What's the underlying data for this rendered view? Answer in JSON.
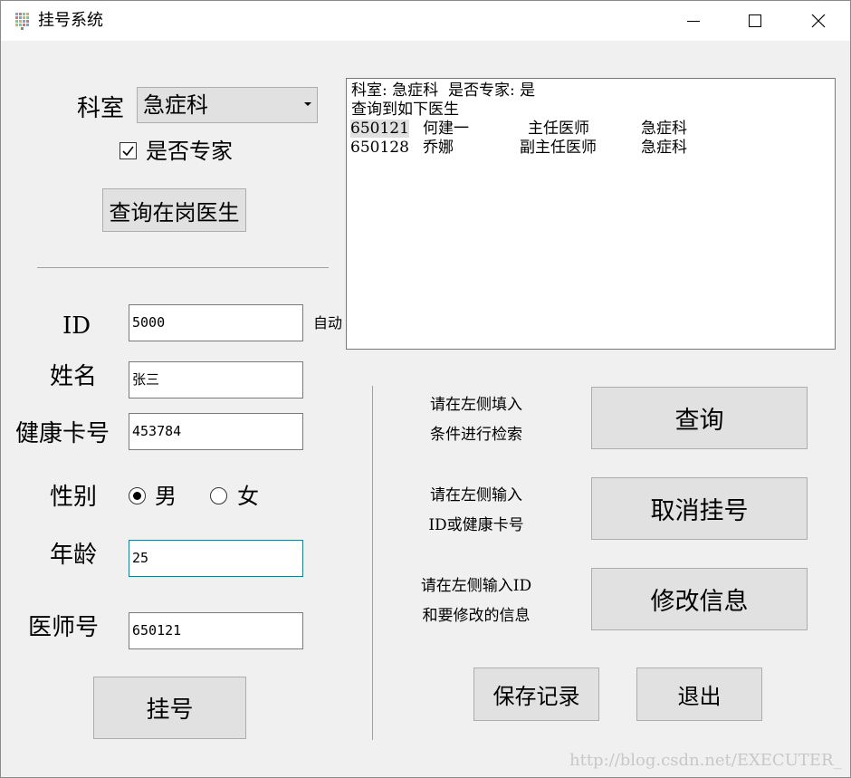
{
  "window": {
    "title": "挂号系统"
  },
  "query_panel": {
    "department_label": "科室",
    "department_value": "急症科",
    "expert_label": "是否专家",
    "expert_checked": true,
    "query_doctors_button": "查询在岗医生"
  },
  "result": {
    "summary_line": "科室: 急症科  是否专家: 是",
    "found_line": "查询到如下医生",
    "rows": [
      {
        "id": "650121",
        "name": "何建一",
        "title": "主任医师",
        "dept": "急症科"
      },
      {
        "id": "650128",
        "name": "乔娜",
        "title": "副主任医师",
        "dept": "急症科"
      }
    ]
  },
  "form": {
    "id_label": "ID",
    "id_value": "5000",
    "id_auto_label": "自动",
    "name_label": "姓名",
    "name_value": "张三",
    "card_label": "健康卡号",
    "card_value": "453784",
    "gender_label": "性别",
    "gender_male": "男",
    "gender_female": "女",
    "gender_selected": "男",
    "age_label": "年龄",
    "age_value": "25",
    "doctor_no_label": "医师号",
    "doctor_no_value": "650121",
    "register_button": "挂号"
  },
  "actions": {
    "search_hint_1": "请在左侧填入",
    "search_hint_2": "条件进行检索",
    "search_button": "查询",
    "cancel_hint_1": "请在左侧输入",
    "cancel_hint_2": "ID或健康卡号",
    "cancel_button": "取消挂号",
    "modify_hint_1": "请在左侧输入ID",
    "modify_hint_2": "和要修改的信息",
    "modify_button": "修改信息",
    "save_button": "保存记录",
    "exit_button": "退出"
  },
  "watermark": "http://blog.csdn.net/EXECUTER_",
  "icons": {
    "app": "app-grid-icon",
    "minimize": "minimize-icon",
    "maximize": "maximize-icon",
    "close": "close-icon",
    "dropdown": "chevron-down-icon",
    "check": "checkmark-icon"
  },
  "colors": {
    "background": "#f0f0f0",
    "titlebar": "#ffffff",
    "button": "#e1e1e1",
    "focus_border": "#1e7f8c",
    "watermark": "#c8c8c8"
  }
}
